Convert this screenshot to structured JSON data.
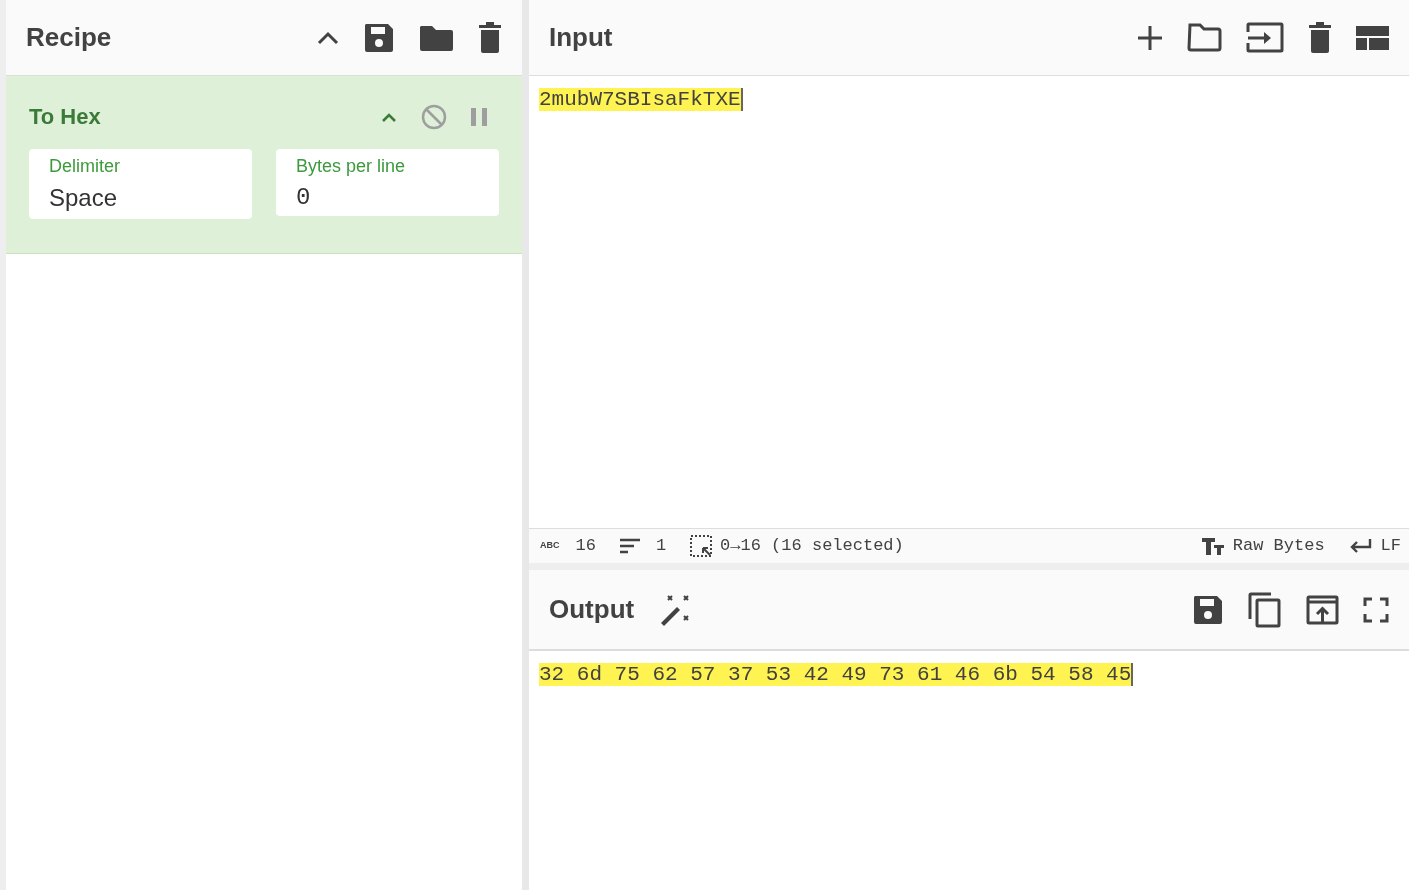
{
  "recipe": {
    "title": "Recipe",
    "operations": [
      {
        "name": "To Hex",
        "disabled": false,
        "args": [
          {
            "label": "Delimiter",
            "value": "Space",
            "kind": "select"
          },
          {
            "label": "Bytes per line",
            "value": "0",
            "kind": "number"
          }
        ]
      }
    ]
  },
  "input": {
    "title": "Input",
    "text": "2mubW7SBIsaFkTXE",
    "highlighted": true
  },
  "status_bar": {
    "chars_icon": "ABC",
    "chars": "16",
    "lines": "1",
    "selection": "0→16 (16 selected)",
    "encoding": "Raw Bytes",
    "eol": "LF"
  },
  "output": {
    "title": "Output",
    "text": "32 6d 75 62 57 37 53 42 49 73 61 46 6b 54 58 45",
    "highlighted": true
  }
}
